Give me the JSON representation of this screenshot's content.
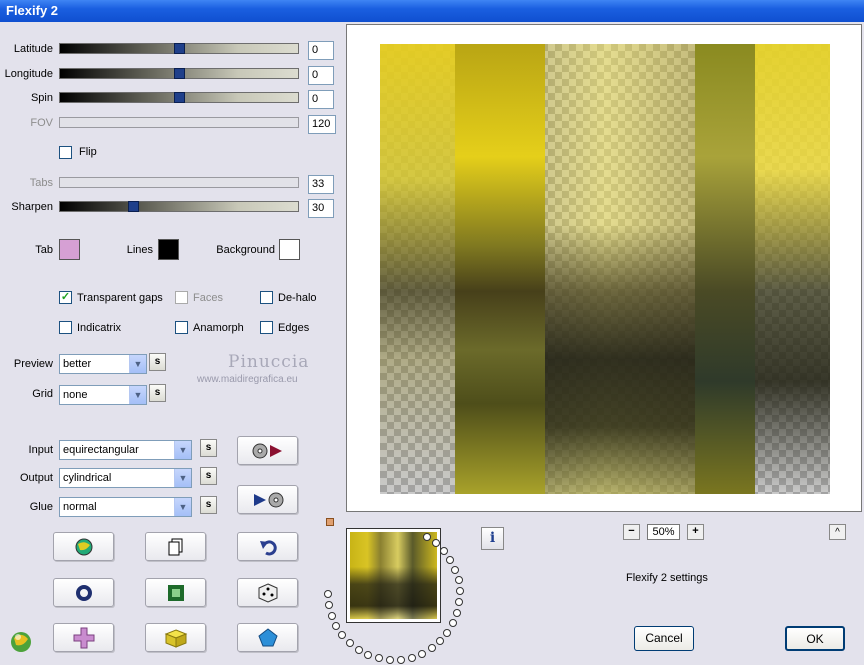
{
  "window": {
    "title": "Flexify 2"
  },
  "sliders": {
    "latitude": {
      "label": "Latitude",
      "value": "0",
      "level": 0.5
    },
    "longitude": {
      "label": "Longitude",
      "value": "0",
      "level": 0.5
    },
    "spin": {
      "label": "Spin",
      "value": "0",
      "level": 0.5
    },
    "fov": {
      "label": "FOV",
      "value": "120"
    },
    "tabs": {
      "label": "Tabs",
      "value": "33"
    },
    "sharpen": {
      "label": "Sharpen",
      "value": "30",
      "level": 0.3
    }
  },
  "flip": {
    "label": "Flip",
    "checked": false
  },
  "colors": {
    "tab": {
      "label": "Tab",
      "color": "#d6a0d4"
    },
    "lines": {
      "label": "Lines",
      "color": "#000000"
    },
    "background": {
      "label": "Background",
      "color": "#ffffff"
    }
  },
  "options": {
    "transparent_gaps": {
      "label": "Transparent gaps",
      "checked": true
    },
    "faces": {
      "label": "Faces",
      "checked": false
    },
    "dehalo": {
      "label": "De-halo",
      "checked": false
    },
    "indicatrix": {
      "label": "Indicatrix",
      "checked": false
    },
    "anamorph": {
      "label": "Anamorph",
      "checked": false
    },
    "edges": {
      "label": "Edges",
      "checked": false
    }
  },
  "preview_quality": {
    "label": "Preview",
    "value": "better"
  },
  "grid": {
    "label": "Grid",
    "value": "none"
  },
  "watermark": {
    "name": "Pinuccia",
    "url": "www.maidiregrafica.eu"
  },
  "input": {
    "label": "Input",
    "value": "equirectangular"
  },
  "output": {
    "label": "Output",
    "value": "cylindrical"
  },
  "glue": {
    "label": "Glue",
    "value": "normal"
  },
  "s_button": "s",
  "zoom": {
    "value": "50%",
    "minus": "−",
    "plus": "+"
  },
  "up_arrow": "^",
  "info": "i",
  "settings_name": "Flexify 2 settings",
  "buttons": {
    "cancel": "Cancel",
    "ok": "OK"
  }
}
